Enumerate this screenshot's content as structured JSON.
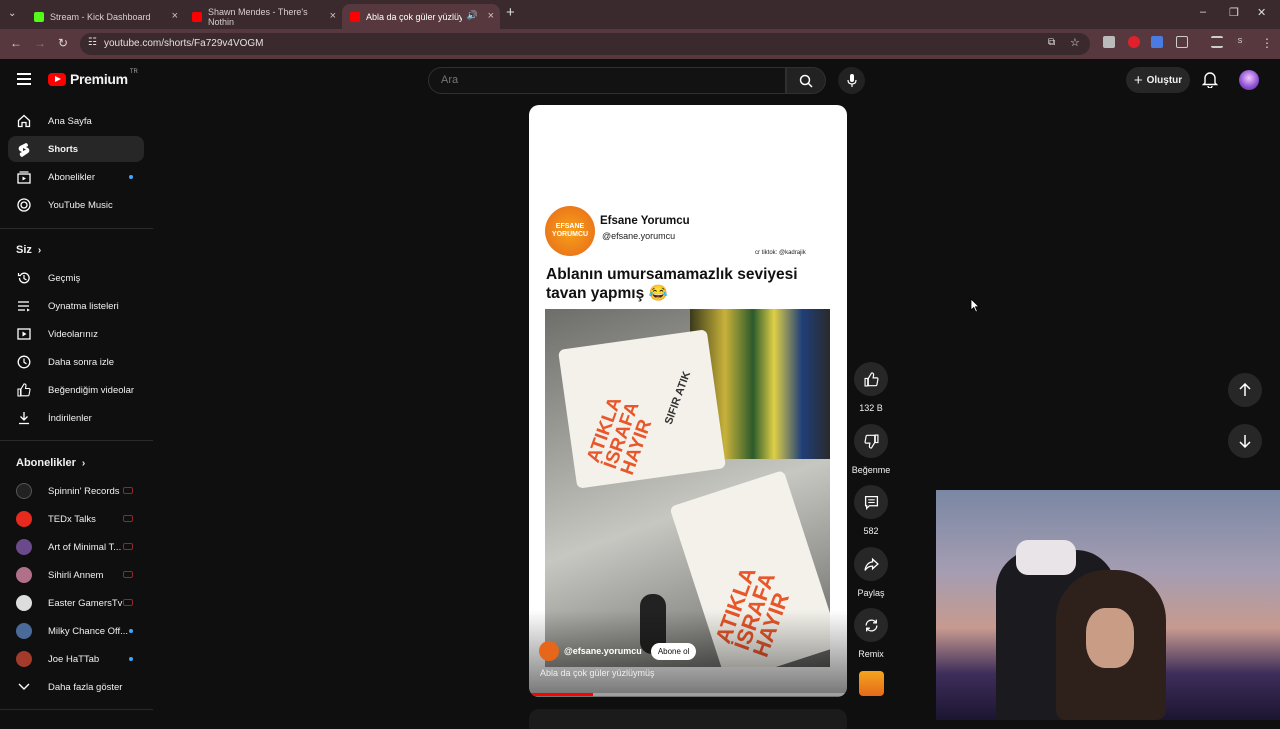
{
  "browser": {
    "tabs": [
      {
        "label": "Stream - Kick Dashboard",
        "fav_color": "#53fc18"
      },
      {
        "label": "Shawn Mendes - There's Nothin",
        "fav_color": "#ff0000"
      },
      {
        "label": "Abla da çok güler yüzlüymüş",
        "fav_color": "#ff0000"
      }
    ],
    "url": "youtube.com/shorts/Fa729v4VOGM",
    "profile_initial": "S"
  },
  "header": {
    "logo_text": "Premium",
    "logo_sup": "TR",
    "search_placeholder": "Ara",
    "create_label": "Oluştur"
  },
  "sidebar": {
    "main": [
      {
        "label": "Ana Sayfa",
        "icon": "home-icon"
      },
      {
        "label": "Shorts",
        "icon": "shorts-icon"
      },
      {
        "label": "Abonelikler",
        "icon": "subscriptions-icon"
      },
      {
        "label": "YouTube Music",
        "icon": "music-icon"
      }
    ],
    "you_header": "Siz",
    "you": [
      {
        "label": "Geçmiş",
        "icon": "history-icon"
      },
      {
        "label": "Oynatma listeleri",
        "icon": "playlist-icon"
      },
      {
        "label": "Videolarınız",
        "icon": "video-icon"
      },
      {
        "label": "Daha sonra izle",
        "icon": "clock-icon"
      },
      {
        "label": "Beğendiğim videolar",
        "icon": "like-icon"
      },
      {
        "label": "İndirilenler",
        "icon": "download-icon"
      }
    ],
    "subs_header": "Abonelikler",
    "subs": [
      {
        "label": "Spinnin' Records",
        "color": "#222222",
        "marker": "live"
      },
      {
        "label": "TEDx Talks",
        "color": "#e62b1e",
        "marker": "live"
      },
      {
        "label": "Art of Minimal T...",
        "color": "#6a4a8a",
        "marker": "live"
      },
      {
        "label": "Sihirli Annem",
        "color": "#b0708a",
        "marker": "live"
      },
      {
        "label": "Easter GamersTv",
        "color": "#dddddd",
        "marker": "live"
      },
      {
        "label": "Milky Chance Off...",
        "color": "#4a6a9a",
        "marker": "dot"
      },
      {
        "label": "Joe HaTTab",
        "color": "#a33a2a",
        "marker": "dot"
      }
    ],
    "more_label": "Daha fazla göster"
  },
  "short": {
    "channel_name": "Efsane Yorumcu",
    "channel_handle": "@efsane.yorumcu",
    "logo_text": "EFSANE YORUMCU",
    "credit": "cr tiktok: @kadrajik",
    "caption": "Ablanın umursamamazlık seviyesi tavan yapmış 😂",
    "bag_text_1": "ATIKLA İSRAFA HAYIR",
    "bag_text_2": "SIFIR ATIK",
    "overlay_handle": "@efsane.yorumcu",
    "subscribe_label": "Abone ol",
    "overlay_title": "Abla da çok güler yüzlüymüş",
    "progress": 0.2
  },
  "actions": {
    "like_count": "132 B",
    "dislike_label": "Beğenme",
    "comment_count": "582",
    "share_label": "Paylaş",
    "remix_label": "Remix"
  }
}
